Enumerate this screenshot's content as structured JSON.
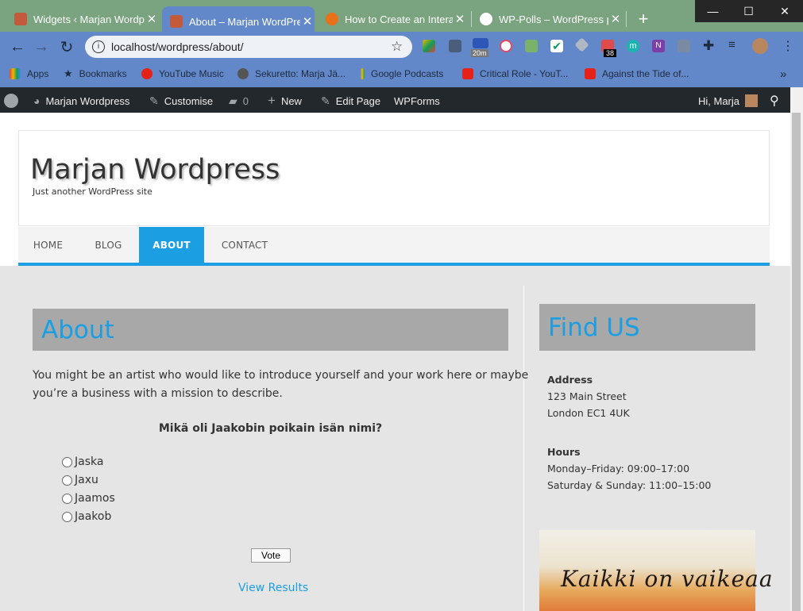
{
  "browser": {
    "tabs": [
      {
        "title": "Widgets ‹ Marjan Wordp",
        "close": "✕"
      },
      {
        "title": "About – Marjan WordPre",
        "close": "✕"
      },
      {
        "title": "How to Create an Intera",
        "close": "✕"
      },
      {
        "title": "WP-Polls – WordPress p",
        "close": "✕"
      }
    ],
    "new_tab": "+",
    "url": "localhost/wordpress/about/",
    "ext_badges": {
      "timer": "20m",
      "count": "38"
    },
    "bookmarks": [
      "Apps",
      "Bookmarks",
      "YouTube Music",
      "Sekuretto: Marja Jä...",
      "Google Podcasts",
      "Critical Role - YouT...",
      "Against the Tide of..."
    ],
    "more_bookmarks": "»"
  },
  "adminbar": {
    "site": "Marjan Wordpress",
    "customise": "Customise",
    "comments": "0",
    "new": "New",
    "edit": "Edit Page",
    "wpforms": "WPForms",
    "greeting": "Hi, Marja"
  },
  "site": {
    "title": "Marjan Wordpress",
    "tagline": "Just another WordPress site",
    "menu": [
      "HOME",
      "BLOG",
      "ABOUT",
      "CONTACT"
    ]
  },
  "main": {
    "heading": "About",
    "para_line1": "You might be an artist who would like to introduce yourself and your work here or maybe",
    "para_line2": "you’re a business with a mission to describe.",
    "poll_question": "Mikä oli Jaakobin poikain isän nimi?",
    "poll_options": [
      "Jaska",
      "Jaxu",
      "Jaamos",
      "Jaakob"
    ],
    "vote": "Vote",
    "view_results": "View Results"
  },
  "sidebar": {
    "heading": "Find US",
    "address_label": "Address",
    "address_line1": "123 Main Street",
    "address_line2": "London EC1 4UK",
    "hours_label": "Hours",
    "hours_line1": "Monday–Friday: 09:00–17:00",
    "hours_line2": "Saturday & Sunday: 11:00–15:00",
    "image_script": "Kaikki on vaikeaa"
  },
  "colors": {
    "accent": "#1b9ee2",
    "adminbar": "#23282d",
    "chrome": "#6388c9",
    "tabstrip": "#7aa37f"
  }
}
